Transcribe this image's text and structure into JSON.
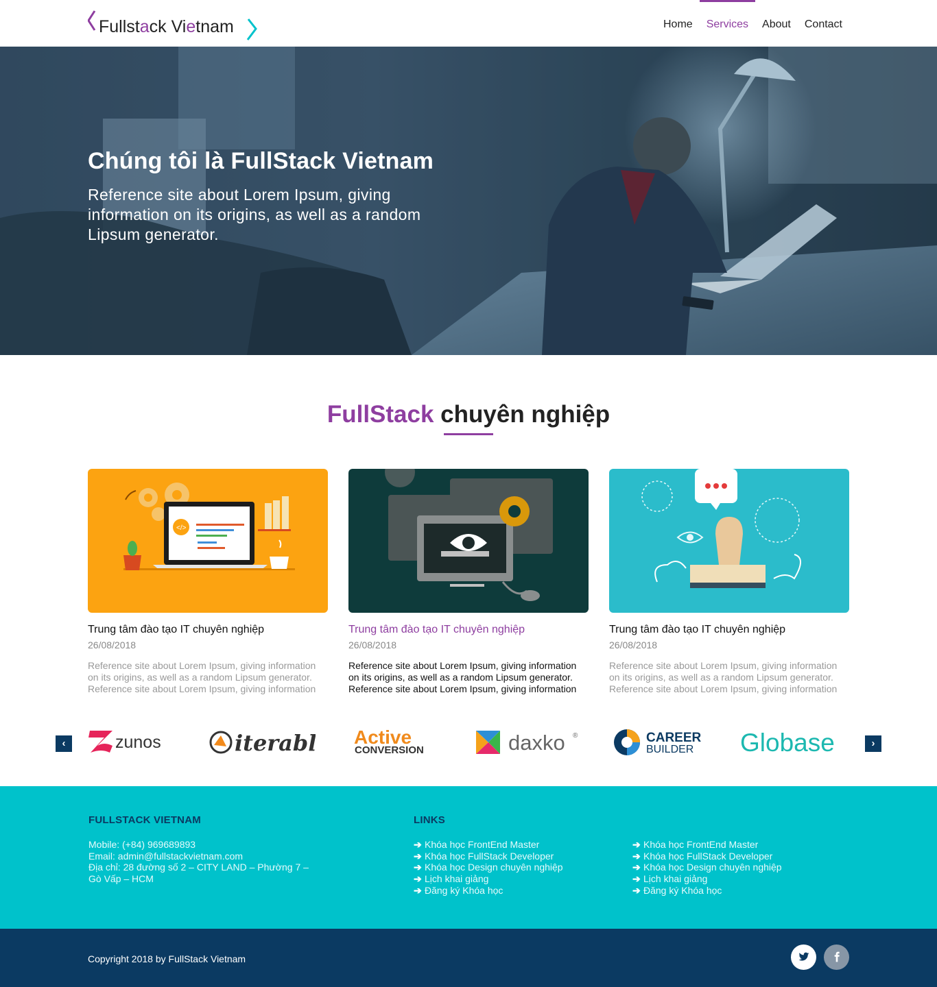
{
  "header": {
    "logo_text": "Fullstack Vietnam",
    "nav": [
      {
        "label": "Home",
        "active": false
      },
      {
        "label": "Services",
        "active": true
      },
      {
        "label": "About",
        "active": false
      },
      {
        "label": "Contact",
        "active": false
      }
    ]
  },
  "hero": {
    "title": "Chúng tôi là FullStack Vietnam",
    "text": "Reference site about Lorem Ipsum, giving information on its origins, as well as a random Lipsum generator."
  },
  "section": {
    "title_accent": "FullStack",
    "title_rest": " chuyên nghiệp"
  },
  "cards": [
    {
      "title": "Trung tâm đào tạo IT chuyên nghiệp",
      "date": "26/08/2018",
      "desc": "Reference site about Lorem Ipsum, giving information on its origins, as well as a random Lipsum generator. Reference site about Lorem Ipsum, giving information on"
    },
    {
      "title": "Trung tâm đào tạo IT chuyên nghiệp",
      "date": "26/08/2018",
      "desc": "Reference site about Lorem Ipsum, giving information on its origins, as well as a random Lipsum generator. Reference site about Lorem Ipsum, giving information on"
    },
    {
      "title": "Trung tâm đào tạo IT chuyên nghiệp",
      "date": "26/08/2018",
      "desc": "Reference site about Lorem Ipsum, giving information on its origins, as well as a random Lipsum generator. Reference site about Lorem Ipsum, giving information on"
    }
  ],
  "partners": {
    "prev_icon": "chevron-left-icon",
    "next_icon": "chevron-right-icon",
    "logos": [
      "zunos",
      "iterable",
      "Active CONVERSION",
      "daxko",
      "CAREER BUILDER",
      "Globase"
    ]
  },
  "footer": {
    "company_heading": "FULLSTACK VIETNAM",
    "mobile": "Mobile: (+84) 969689893",
    "email": "Email: admin@fullstackvietnam.com",
    "address": "Địa chỉ: 28 đường số 2 – CITY LAND – Phường 7 – Gò Vấp – HCM",
    "links_heading": "LINKS",
    "links_col1": [
      "Khóa học FrontEnd Master",
      "Khóa học FullStack Developer",
      "Khóa học Design chuyên nghiệp",
      "Lịch khai giảng",
      "Đăng ký Khóa học"
    ],
    "links_col2": [
      "Khóa học FrontEnd Master",
      "Khóa học FullStack Developer",
      "Khóa học Design chuyên nghiệp",
      "Lịch khai giảng",
      "Đăng ký Khóa học"
    ]
  },
  "bottom": {
    "copyright": "Copyright 2018 by FullStack Vietnam",
    "social": [
      "twitter-icon",
      "facebook-icon"
    ]
  },
  "colors": {
    "accent": "#8e3ea0",
    "footer_bg": "#00c2cb",
    "bottom_bg": "#0b3a62"
  }
}
